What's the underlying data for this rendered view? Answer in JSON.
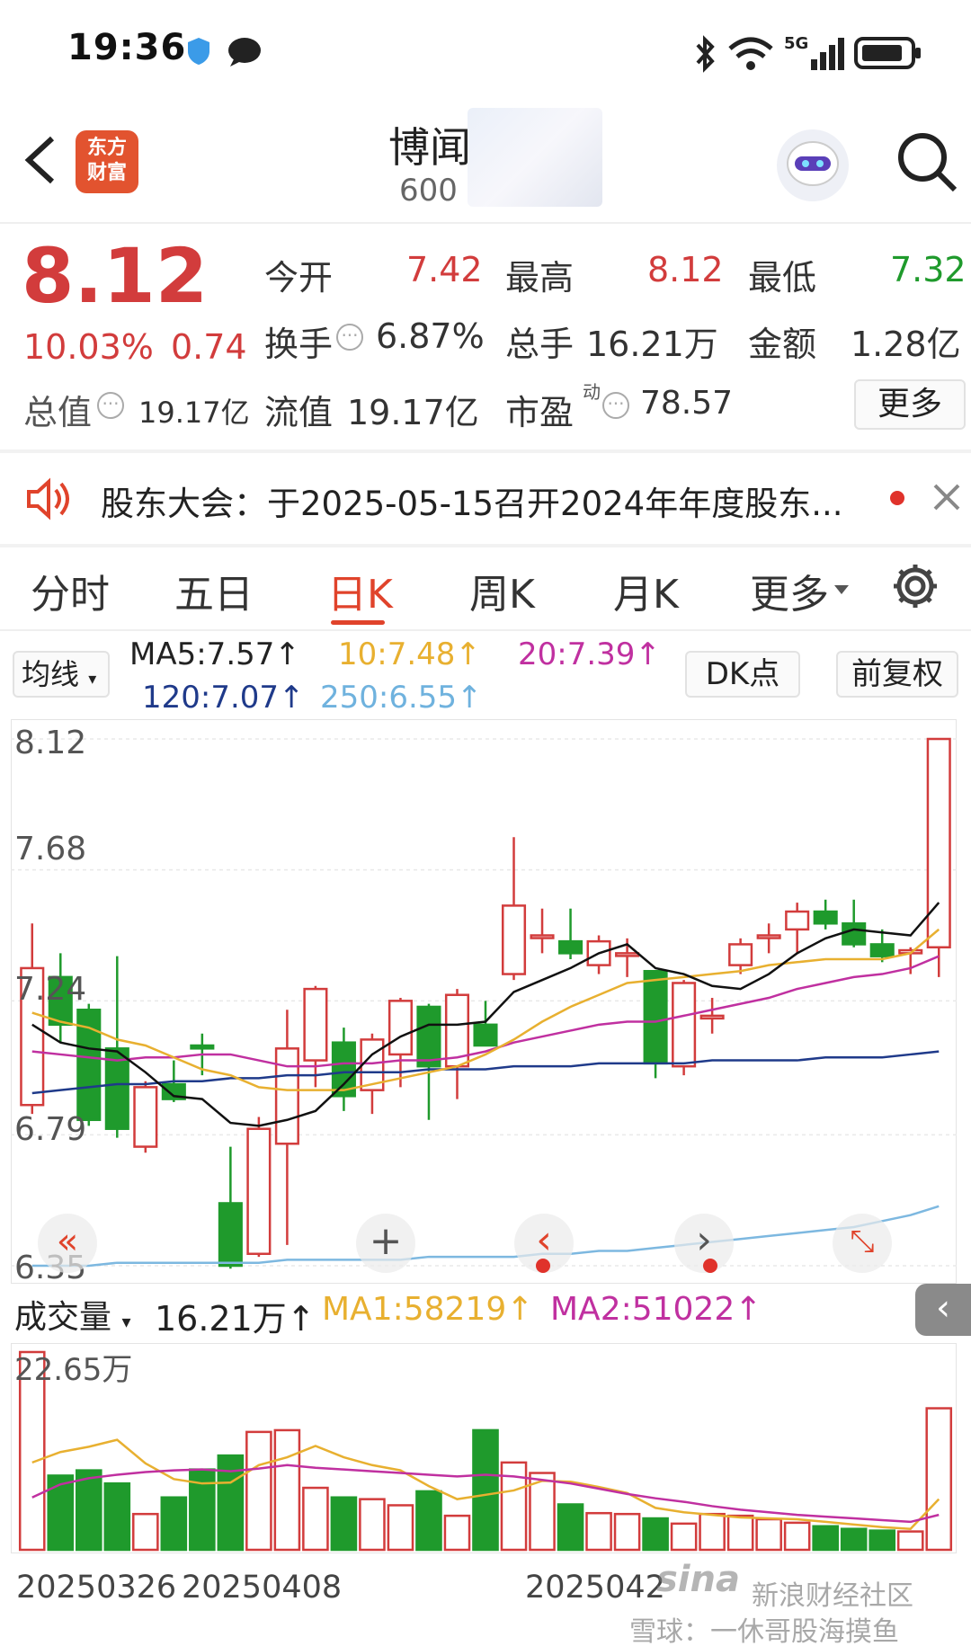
{
  "status": {
    "time": "19:36"
  },
  "header": {
    "logo_line1": "东方",
    "logo_line2": "财富",
    "stock_name": "博闻",
    "stock_code": "600"
  },
  "quote": {
    "price": "8.12",
    "change_pct": "10.03%",
    "change_abs": "0.74",
    "open_label": "今开",
    "open": "7.42",
    "high_label": "最高",
    "high": "8.12",
    "low_label": "最低",
    "low": "7.32",
    "turnover_label": "换手",
    "turnover": "6.87%",
    "volume_label": "总手",
    "volume": "16.21万",
    "amount_label": "金额",
    "amount": "1.28亿",
    "mktcap_label": "总值",
    "mktcap": "19.17亿",
    "float_label": "流值",
    "float": "19.17亿",
    "pe_label": "市盈",
    "pe_sup": "动",
    "pe": "78.57",
    "more_btn": "更多"
  },
  "notice": {
    "text": "股东大会：于2025-05-15召开2024年年度股东..."
  },
  "tabs": [
    "分时",
    "五日",
    "日K",
    "周K",
    "月K",
    "更多"
  ],
  "ma_bar": {
    "selector": "均线",
    "ma5": "MA5:7.57↑",
    "ma10": "10:7.48↑",
    "ma20": "20:7.39↑",
    "ma120": "120:7.07↑",
    "ma250": "250:6.55↑",
    "dk_btn": "DK点",
    "adjust_btn": "前复权"
  },
  "colors": {
    "up": "#d23c3c",
    "down": "#1f9a2c",
    "ma5": "#111111",
    "ma10": "#e8b030",
    "ma20": "#c030a0",
    "ma120": "#1f3a8a",
    "ma250": "#7db8e0",
    "accent": "#e0432b"
  },
  "volume_bar": {
    "selector": "成交量",
    "vol": "16.21万↑",
    "ma1": "MA1:58219↑",
    "ma2": "MA2:51022↑"
  },
  "watermark": {
    "site": "新浪财经社区",
    "snowball": "雪球：一休哥股海摸鱼"
  },
  "chart_data": {
    "type": "candlestick",
    "y_ticks": [
      "8.12",
      "7.68",
      "7.24",
      "6.79",
      "6.35"
    ],
    "ylim": [
      6.35,
      8.12
    ],
    "x_labels": [
      "20250326",
      "20250408",
      "2025042"
    ],
    "volume_max_label": "22.65万",
    "candles": [
      {
        "o": 6.89,
        "c": 7.35,
        "h": 7.5,
        "l": 6.86
      },
      {
        "o": 7.32,
        "c": 7.16,
        "h": 7.4,
        "l": 7.1
      },
      {
        "o": 7.21,
        "c": 6.84,
        "h": 7.23,
        "l": 6.82
      },
      {
        "o": 7.08,
        "c": 6.81,
        "h": 7.39,
        "l": 6.78
      },
      {
        "o": 6.75,
        "c": 6.95,
        "h": 6.97,
        "l": 6.73
      },
      {
        "o": 6.96,
        "c": 6.91,
        "h": 7.04,
        "l": 6.9
      },
      {
        "o": 7.09,
        "c": 7.08,
        "h": 7.13,
        "l": 6.99
      },
      {
        "o": 6.56,
        "c": 6.35,
        "h": 6.75,
        "l": 6.34
      },
      {
        "o": 6.39,
        "c": 6.81,
        "h": 6.85,
        "l": 6.38
      },
      {
        "o": 6.76,
        "c": 7.08,
        "h": 7.21,
        "l": 6.42
      },
      {
        "o": 7.04,
        "c": 7.28,
        "h": 7.29,
        "l": 6.95
      },
      {
        "o": 7.1,
        "c": 6.92,
        "h": 7.15,
        "l": 6.87
      },
      {
        "o": 6.94,
        "c": 7.11,
        "h": 7.13,
        "l": 6.86
      },
      {
        "o": 7.06,
        "c": 7.24,
        "h": 7.25,
        "l": 6.95
      },
      {
        "o": 7.22,
        "c": 7.02,
        "h": 7.23,
        "l": 6.84
      },
      {
        "o": 7.02,
        "c": 7.26,
        "h": 7.28,
        "l": 6.91
      },
      {
        "o": 7.16,
        "c": 7.09,
        "h": 7.24,
        "l": 7.12
      },
      {
        "o": 7.33,
        "c": 7.56,
        "h": 7.79,
        "l": 7.31
      },
      {
        "o": 7.46,
        "c": 7.46,
        "h": 7.55,
        "l": 7.4
      },
      {
        "o": 7.44,
        "c": 7.4,
        "h": 7.55,
        "l": 7.38
      },
      {
        "o": 7.36,
        "c": 7.44,
        "h": 7.46,
        "l": 7.33
      },
      {
        "o": 7.4,
        "c": 7.4,
        "h": 7.45,
        "l": 7.32
      },
      {
        "o": 7.34,
        "c": 7.03,
        "h": 7.34,
        "l": 6.98
      },
      {
        "o": 7.02,
        "c": 7.3,
        "h": 7.31,
        "l": 6.99
      },
      {
        "o": 7.19,
        "c": 7.19,
        "h": 7.25,
        "l": 7.13
      },
      {
        "o": 7.36,
        "c": 7.43,
        "h": 7.45,
        "l": 7.33
      },
      {
        "o": 7.46,
        "c": 7.46,
        "h": 7.5,
        "l": 7.4
      },
      {
        "o": 7.48,
        "c": 7.54,
        "h": 7.57,
        "l": 7.4
      },
      {
        "o": 7.54,
        "c": 7.5,
        "h": 7.58,
        "l": 7.48
      },
      {
        "o": 7.5,
        "c": 7.43,
        "h": 7.58,
        "l": 7.42
      },
      {
        "o": 7.43,
        "c": 7.39,
        "h": 7.48,
        "l": 7.37
      },
      {
        "o": 7.4,
        "c": 7.41,
        "h": 7.42,
        "l": 7.33
      },
      {
        "o": 7.42,
        "c": 8.12,
        "h": 8.12,
        "l": 7.32
      }
    ],
    "ma5": [
      7.16,
      7.1,
      7.08,
      7.07,
      7.0,
      6.92,
      6.91,
      6.83,
      6.82,
      6.84,
      6.87,
      6.96,
      7.06,
      7.12,
      7.16,
      7.16,
      7.17,
      7.27,
      7.31,
      7.35,
      7.4,
      7.43,
      7.35,
      7.33,
      7.29,
      7.28,
      7.33,
      7.4,
      7.45,
      7.48,
      7.47,
      7.46,
      7.57
    ],
    "ma10": [
      7.2,
      7.17,
      7.15,
      7.11,
      7.09,
      7.05,
      7.01,
      6.99,
      6.95,
      6.94,
      6.94,
      6.94,
      6.96,
      6.98,
      7.0,
      7.02,
      7.06,
      7.11,
      7.17,
      7.22,
      7.26,
      7.3,
      7.31,
      7.32,
      7.33,
      7.34,
      7.36,
      7.37,
      7.38,
      7.38,
      7.38,
      7.4,
      7.48
    ],
    "ma20": [
      7.07,
      7.06,
      7.05,
      7.04,
      7.05,
      7.05,
      7.06,
      7.06,
      7.04,
      7.02,
      7.02,
      7.03,
      7.03,
      7.04,
      7.04,
      7.05,
      7.07,
      7.1,
      7.12,
      7.14,
      7.16,
      7.17,
      7.17,
      7.19,
      7.21,
      7.23,
      7.25,
      7.28,
      7.3,
      7.32,
      7.33,
      7.35,
      7.39
    ],
    "ma120": [
      6.93,
      6.94,
      6.95,
      6.96,
      6.96,
      6.97,
      6.97,
      6.98,
      6.98,
      6.99,
      6.99,
      7.0,
      7.0,
      7.0,
      7.01,
      7.01,
      7.01,
      7.02,
      7.02,
      7.02,
      7.03,
      7.03,
      7.03,
      7.03,
      7.04,
      7.04,
      7.04,
      7.04,
      7.05,
      7.05,
      7.05,
      7.06,
      7.07
    ],
    "ma250": [
      6.35,
      6.35,
      6.35,
      6.36,
      6.36,
      6.36,
      6.36,
      6.36,
      6.36,
      6.37,
      6.37,
      6.37,
      6.37,
      6.37,
      6.38,
      6.38,
      6.38,
      6.38,
      6.39,
      6.39,
      6.4,
      6.4,
      6.41,
      6.42,
      6.43,
      6.44,
      6.45,
      6.46,
      6.47,
      6.48,
      6.5,
      6.52,
      6.55
    ],
    "volumes": [
      22.65,
      8.5,
      9.1,
      7.6,
      4.1,
      6.0,
      9.2,
      10.8,
      13.5,
      13.7,
      7.1,
      6.0,
      5.8,
      5.1,
      6.7,
      3.9,
      13.7,
      10.0,
      8.8,
      5.2,
      4.2,
      4.1,
      3.6,
      3.0,
      4.1,
      3.9,
      3.5,
      3.1,
      2.7,
      2.4,
      2.2,
      2.1,
      16.21
    ],
    "vol_ma1": [
      10.0,
      11.2,
      11.8,
      12.6,
      9.9,
      8.1,
      7.6,
      7.7,
      9.7,
      10.6,
      11.9,
      10.6,
      9.7,
      9.1,
      7.3,
      5.8,
      6.3,
      6.8,
      7.9,
      7.8,
      7.2,
      6.5,
      4.8,
      4.3,
      4.0,
      3.7,
      3.6,
      3.5,
      3.2,
      2.9,
      2.6,
      2.4,
      5.8
    ],
    "vol_ma2": [
      6.0,
      7.5,
      8.2,
      8.6,
      8.9,
      9.1,
      9.2,
      9.0,
      9.3,
      9.7,
      9.4,
      9.2,
      9.0,
      8.8,
      8.6,
      8.4,
      8.6,
      8.4,
      8.0,
      7.6,
      7.0,
      6.4,
      5.9,
      5.5,
      5.0,
      4.6,
      4.3,
      4.0,
      3.8,
      3.6,
      3.4,
      3.2,
      4.0
    ]
  }
}
